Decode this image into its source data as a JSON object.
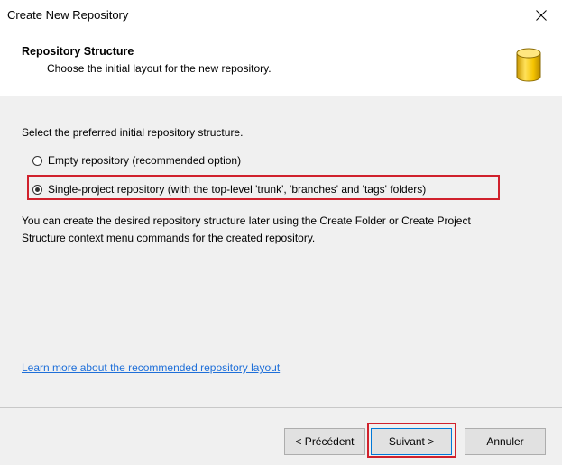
{
  "window": {
    "title": "Create New Repository"
  },
  "header": {
    "title": "Repository Structure",
    "subtitle": "Choose the initial layout for the new repository.",
    "icon": "database-icon"
  },
  "content": {
    "prompt": "Select the preferred initial repository structure.",
    "options": [
      {
        "label": "Empty repository (recommended option)",
        "selected": false
      },
      {
        "label": "Single-project repository (with the top-level 'trunk', 'branches' and 'tags' folders)",
        "selected": true
      }
    ],
    "info_line1": "You can create the desired repository structure later using the Create Folder or Create Project",
    "info_line2": "Structure context menu commands for the created repository.",
    "learn_more_link": "Learn more about the recommended repository layout"
  },
  "footer": {
    "prev_label": "< Précédent",
    "next_label": "Suivant >",
    "cancel_label": "Annuler"
  },
  "colors": {
    "highlight": "#d0212c",
    "link": "#1e6fd9",
    "content_bg": "#f0f0f0",
    "icon_gold": "#f5c400"
  }
}
